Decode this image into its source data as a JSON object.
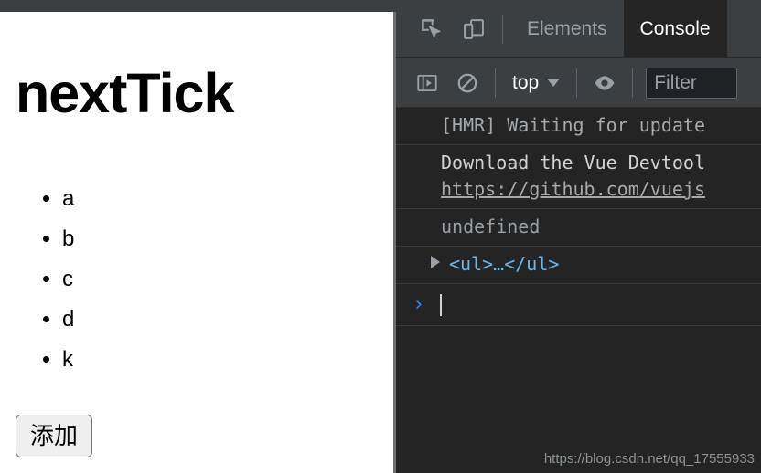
{
  "page": {
    "title": "nextTick",
    "list_items": [
      "a",
      "b",
      "c",
      "d",
      "k"
    ],
    "add_button_label": "添加"
  },
  "devtools": {
    "tabbar": {
      "inspect_icon": "inspect-element-icon",
      "device_icon": "device-toolbar-icon",
      "tabs": [
        {
          "label": "Elements",
          "active": false
        },
        {
          "label": "Console",
          "active": true
        }
      ]
    },
    "console_toolbar": {
      "sidebar_icon": "console-sidebar-icon",
      "clear_icon": "clear-console-icon",
      "context_label": "top",
      "eye_icon": "live-expression-eye-icon",
      "filter_placeholder": "Filter"
    },
    "console_messages": [
      {
        "kind": "info",
        "text": "[HMR] Waiting for update"
      },
      {
        "kind": "plain",
        "text": "Download the Vue Devtool",
        "link": "https://github.com/vuejs"
      },
      {
        "kind": "result",
        "text": "undefined"
      },
      {
        "kind": "object",
        "text": "<ul>…</ul>"
      }
    ],
    "prompt": {
      "chevron": "›"
    },
    "watermark": "https://blog.csdn.net/qq_17555933"
  },
  "colors": {
    "devtools_bg": "#242424",
    "toolbar_bg": "#3c3f41",
    "accent_blue": "#3b82f6",
    "object_cyan": "#6fb5e8",
    "muted_text": "#9aa0a6"
  }
}
